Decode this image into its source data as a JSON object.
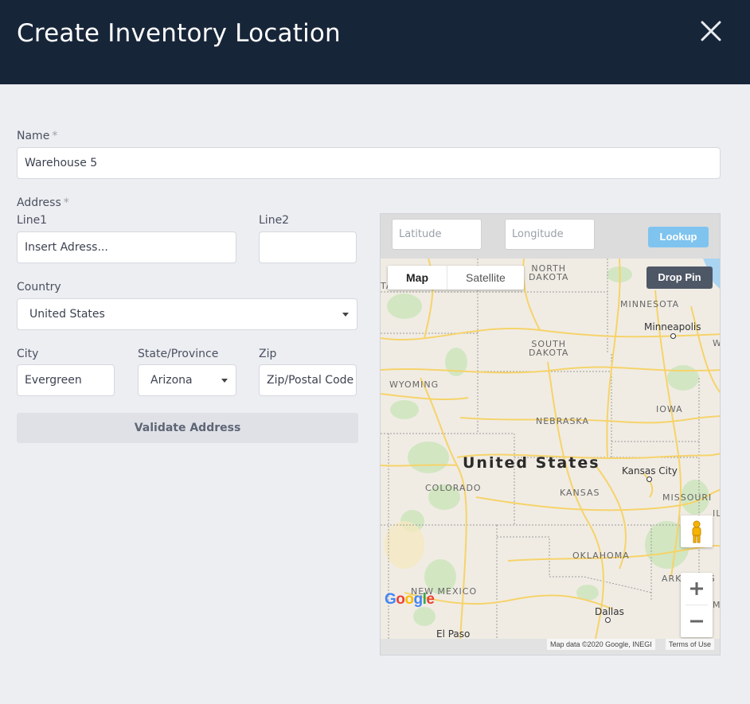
{
  "header": {
    "title": "Create Inventory Location",
    "close_icon": "close-icon"
  },
  "form": {
    "name_label": "Name",
    "name_value": "Warehouse 5",
    "required_mark": "*",
    "address_label": "Address",
    "line1_label": "Line1",
    "line1_value": "Insert Adress...",
    "line2_label": "Line2",
    "line2_value": "",
    "country_label": "Country",
    "country_value": "United States",
    "city_label": "City",
    "city_value": "Evergreen",
    "state_label": "State/Province",
    "state_value": "Arizona",
    "zip_label": "Zip",
    "zip_placeholder": "Zip/Postal Code",
    "validate_label": "Validate Address"
  },
  "map": {
    "latitude_placeholder": "Latitude",
    "longitude_placeholder": "Longitude",
    "lookup_label": "Lookup",
    "maptype_map": "Map",
    "maptype_satellite": "Satellite",
    "drop_pin_label": "Drop Pin",
    "country_label": "United States",
    "state_labels": {
      "north_dakota": "NORTH\nDAKOTA",
      "south_dakota": "SOUTH\nDAKOTA",
      "minnesota": "MINNESOTA",
      "wyoming": "WYOMING",
      "nebraska": "NEBRASKA",
      "iowa": "IOWA",
      "colorado": "COLORADO",
      "kansas": "KANSAS",
      "missouri": "MISSOURI",
      "oklahoma": "OKLAHOMA",
      "arkansas": "ARKANSAS",
      "new_mexico": "NEW MEXICO",
      "montana_partial": "TANA",
      "wisconsin_partial": "W",
      "illinois_partial": "IL",
      "mississippi_partial": "MI"
    },
    "cities": {
      "minneapolis": "Minneapolis",
      "kansas_city": "Kansas City",
      "dallas": "Dallas",
      "el_paso": "El Paso"
    },
    "attribution": "Map data ©2020 Google, INEGI",
    "terms": "Terms of Use",
    "google_logo": "Google",
    "colors": {
      "water": "#a9d4f2",
      "roads": "#f6d36a",
      "park": "#cfe6bf",
      "land": "#f0ece4"
    }
  }
}
